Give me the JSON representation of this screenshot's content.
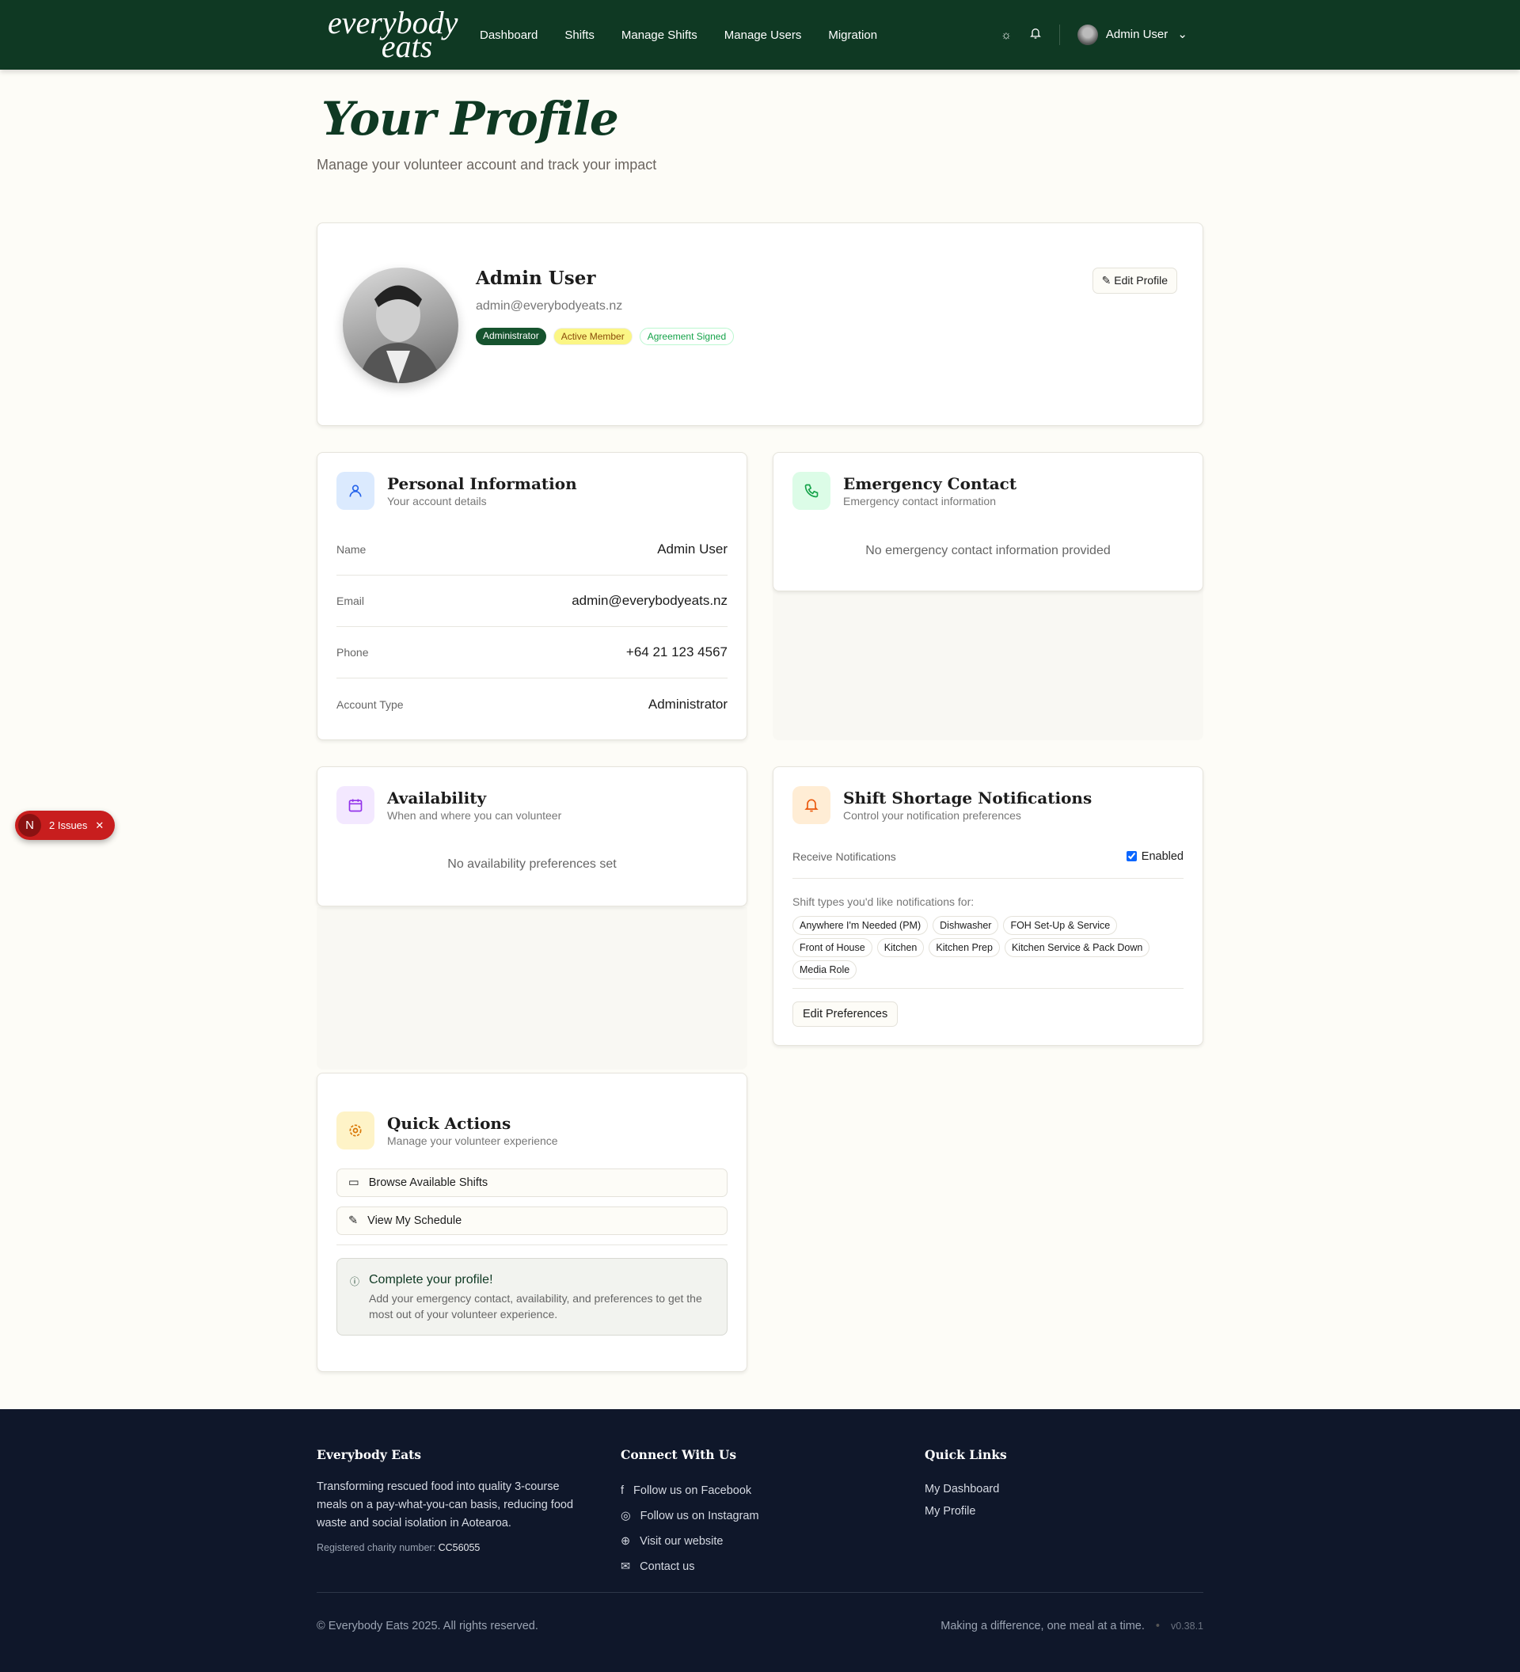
{
  "nav": {
    "logo_line1": "everybody",
    "logo_line2": "eats",
    "links": [
      "Dashboard",
      "Shifts",
      "Manage Shifts",
      "Manage Users",
      "Migration"
    ],
    "user": "Admin User"
  },
  "page": {
    "title": "Your Profile",
    "subtitle": "Manage your volunteer account and track your impact"
  },
  "profile": {
    "name": "Admin User",
    "email": "admin@everybodyeats.nz",
    "badges": [
      "Administrator",
      "Active Member",
      "Agreement Signed"
    ],
    "edit_label": "Edit Profile"
  },
  "personal": {
    "title": "Personal Information",
    "subtitle": "Your account details",
    "rows": [
      {
        "label": "Name",
        "value": "Admin User"
      },
      {
        "label": "Email",
        "value": "admin@everybodyeats.nz"
      },
      {
        "label": "Phone",
        "value": "+64 21 123 4567"
      },
      {
        "label": "Account Type",
        "value": "Administrator"
      }
    ]
  },
  "emergency": {
    "title": "Emergency Contact",
    "subtitle": "Emergency contact information",
    "empty": "No emergency contact information provided"
  },
  "availability": {
    "title": "Availability",
    "subtitle": "When and where you can volunteer",
    "empty": "No availability preferences set"
  },
  "notifications": {
    "title": "Shift Shortage Notifications",
    "subtitle": "Control your notification preferences",
    "receive_label": "Receive Notifications",
    "enabled_label": "Enabled",
    "enabled": true,
    "types_label": "Shift types you'd like notifications for:",
    "types": [
      "Anywhere I'm Needed (PM)",
      "Dishwasher",
      "FOH Set-Up & Service",
      "Front of House",
      "Kitchen",
      "Kitchen Prep",
      "Kitchen Service & Pack Down",
      "Media Role"
    ],
    "edit_label": "Edit Preferences"
  },
  "quick": {
    "title": "Quick Actions",
    "subtitle": "Manage your volunteer experience",
    "browse": "Browse Available Shifts",
    "schedule": "View My Schedule",
    "complete_title": "Complete your profile!",
    "complete_text": "Add your emergency contact, availability, and preferences to get the most out of your volunteer experience."
  },
  "issues": {
    "label": "2 Issues",
    "logo": "N"
  },
  "footer": {
    "about_title": "Everybody Eats",
    "about_text": "Transforming rescued food into quality 3-course meals on a pay-what-you-can basis, reducing food waste and social isolation in Aotearoa.",
    "charity_label": "Registered charity number:",
    "charity_number": "CC56055",
    "connect_title": "Connect With Us",
    "connect": [
      "Follow us on Facebook",
      "Follow us on Instagram",
      "Visit our website",
      "Contact us"
    ],
    "links_title": "Quick Links",
    "links": [
      "My Dashboard",
      "My Profile"
    ],
    "copyright": "© Everybody Eats 2025. All rights reserved.",
    "tagline": "Making a difference, one meal at a time.",
    "version": "v0.38.1"
  },
  "colors": {
    "brand": "#0f3923",
    "footer": "#0f172a"
  }
}
